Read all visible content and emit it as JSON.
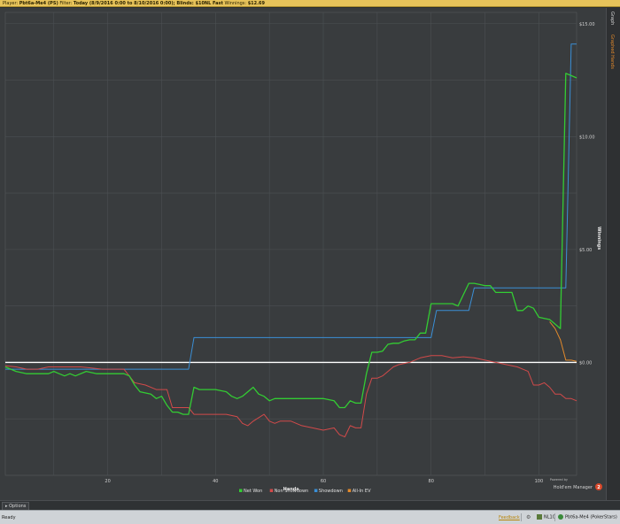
{
  "header": {
    "player_label": "Player:",
    "player": "Pbt6a-Me4 (PS)",
    "filter_label": "Filter:",
    "filter": "Today (8/9/2016 0:00 to 8/10/2016 0:00); Blinds: $10NL Fast",
    "winnings_label": "Winnings:",
    "winnings": "$12.69"
  },
  "sidebar": {
    "tab_graph": "Graph",
    "tab_graphed_hands": "Graphed Hands"
  },
  "branding": {
    "powered_by": "Powered by",
    "product": "Hold'em Manager",
    "badge": "2"
  },
  "options": {
    "label": "Options",
    "arrow": "▸"
  },
  "status": {
    "ready": "Ready",
    "feedback": "Feedback",
    "gear_icon": "gear-icon",
    "stake": "NL10",
    "player_site": "Pbt6a-Me4 (PokerStars)"
  },
  "colors": {
    "net_won": "#33cc33",
    "non_showdown": "#d24a4a",
    "showdown": "#3a8fd6",
    "all_in_ev": "#e38a2b",
    "zero_line": "#ffffff",
    "plot_bg": "#393c3e"
  },
  "chart_data": {
    "type": "line",
    "xlabel": "Hands",
    "ylabel": "Winnings",
    "xlim": [
      1,
      107
    ],
    "ylim": [
      -5,
      15.5
    ],
    "xticks": [
      20,
      40,
      60,
      80,
      100
    ],
    "xtick_labels": [
      "20",
      "40",
      "60",
      "80",
      "100"
    ],
    "yticks": [
      0,
      5,
      10,
      15
    ],
    "ytick_labels": [
      "$0.00",
      "$5.00",
      "$10.00",
      "$15.00"
    ],
    "grid": true,
    "legend_position": "bottom-center",
    "series": [
      {
        "name": "Net Won",
        "x": [
          1,
          3,
          5,
          7,
          9,
          10,
          11,
          12,
          13,
          14,
          16,
          18,
          20,
          22,
          23,
          24,
          25,
          26,
          28,
          29,
          30,
          31,
          32,
          33,
          34,
          35,
          36,
          37,
          38,
          40,
          42,
          43,
          44,
          45,
          46,
          47,
          48,
          49,
          50,
          51,
          52,
          53,
          54,
          55,
          56,
          58,
          60,
          62,
          63,
          64,
          65,
          66,
          67,
          68,
          69,
          70,
          71,
          72,
          73,
          74,
          75,
          76,
          77,
          78,
          79,
          80,
          81,
          82,
          83,
          84,
          85,
          86,
          87,
          88,
          89,
          90,
          91,
          92,
          93,
          94,
          95,
          96,
          97,
          98,
          99,
          100,
          101,
          102,
          103,
          104,
          105,
          106,
          107
        ],
        "y": [
          -0.2,
          -0.4,
          -0.5,
          -0.5,
          -0.5,
          -0.4,
          -0.5,
          -0.6,
          -0.5,
          -0.6,
          -0.4,
          -0.5,
          -0.5,
          -0.5,
          -0.5,
          -0.6,
          -1.0,
          -1.3,
          -1.4,
          -1.6,
          -1.5,
          -1.9,
          -2.2,
          -2.2,
          -2.3,
          -2.3,
          -1.1,
          -1.2,
          -1.2,
          -1.2,
          -1.3,
          -1.5,
          -1.6,
          -1.5,
          -1.3,
          -1.1,
          -1.4,
          -1.5,
          -1.7,
          -1.6,
          -1.6,
          -1.6,
          -1.6,
          -1.6,
          -1.6,
          -1.6,
          -1.6,
          -1.7,
          -2.0,
          -2.0,
          -1.7,
          -1.8,
          -1.8,
          -0.5,
          0.45,
          0.45,
          0.5,
          0.8,
          0.85,
          0.85,
          0.95,
          1.0,
          1.0,
          1.3,
          1.3,
          2.6,
          2.6,
          2.6,
          2.6,
          2.6,
          2.5,
          3.0,
          3.5,
          3.5,
          3.45,
          3.4,
          3.4,
          3.1,
          3.1,
          3.1,
          3.1,
          2.3,
          2.3,
          2.5,
          2.4,
          2.0,
          1.95,
          1.9,
          1.7,
          1.5,
          12.8,
          12.7,
          12.6
        ]
      },
      {
        "name": "Non Showdown",
        "x": [
          1,
          3,
          5,
          7,
          9,
          11,
          13,
          15,
          17,
          19,
          21,
          23,
          25,
          27,
          29,
          31,
          32,
          33,
          35,
          36,
          37,
          40,
          42,
          44,
          45,
          46,
          47,
          49,
          50,
          51,
          52,
          54,
          56,
          58,
          60,
          62,
          63,
          64,
          65,
          66,
          67,
          68,
          69,
          70,
          71,
          72,
          73,
          74,
          76,
          78,
          80,
          82,
          84,
          86,
          88,
          90,
          92,
          94,
          96,
          97,
          98,
          99,
          100,
          101,
          102,
          103,
          104,
          105,
          106,
          107
        ],
        "y": [
          -0.15,
          -0.2,
          -0.3,
          -0.3,
          -0.2,
          -0.2,
          -0.2,
          -0.2,
          -0.25,
          -0.3,
          -0.3,
          -0.3,
          -0.9,
          -1.0,
          -1.2,
          -1.2,
          -2.0,
          -2.0,
          -2.0,
          -2.3,
          -2.3,
          -2.3,
          -2.3,
          -2.4,
          -2.7,
          -2.8,
          -2.6,
          -2.3,
          -2.6,
          -2.7,
          -2.6,
          -2.6,
          -2.8,
          -2.9,
          -3.0,
          -2.9,
          -3.2,
          -3.3,
          -2.8,
          -2.9,
          -2.9,
          -1.4,
          -0.7,
          -0.7,
          -0.6,
          -0.4,
          -0.2,
          -0.1,
          0.0,
          0.2,
          0.3,
          0.3,
          0.2,
          0.25,
          0.2,
          0.1,
          0.0,
          -0.1,
          -0.2,
          -0.3,
          -0.4,
          -1.0,
          -1.0,
          -0.9,
          -1.1,
          -1.4,
          -1.4,
          -1.6,
          -1.6,
          -1.7
        ]
      },
      {
        "name": "Showdown",
        "x": [
          1,
          35,
          36,
          76,
          77,
          80,
          81,
          83,
          84,
          87,
          88,
          105,
          106,
          107
        ],
        "y": [
          -0.3,
          -0.3,
          1.1,
          1.1,
          1.1,
          1.1,
          2.3,
          2.3,
          2.3,
          2.3,
          3.3,
          3.3,
          14.1,
          14.1
        ]
      },
      {
        "name": "All-In EV",
        "x": [
          102,
          103,
          104,
          105,
          106,
          107
        ],
        "y": [
          1.8,
          1.5,
          1.0,
          0.1,
          0.1,
          0.05
        ]
      }
    ]
  }
}
